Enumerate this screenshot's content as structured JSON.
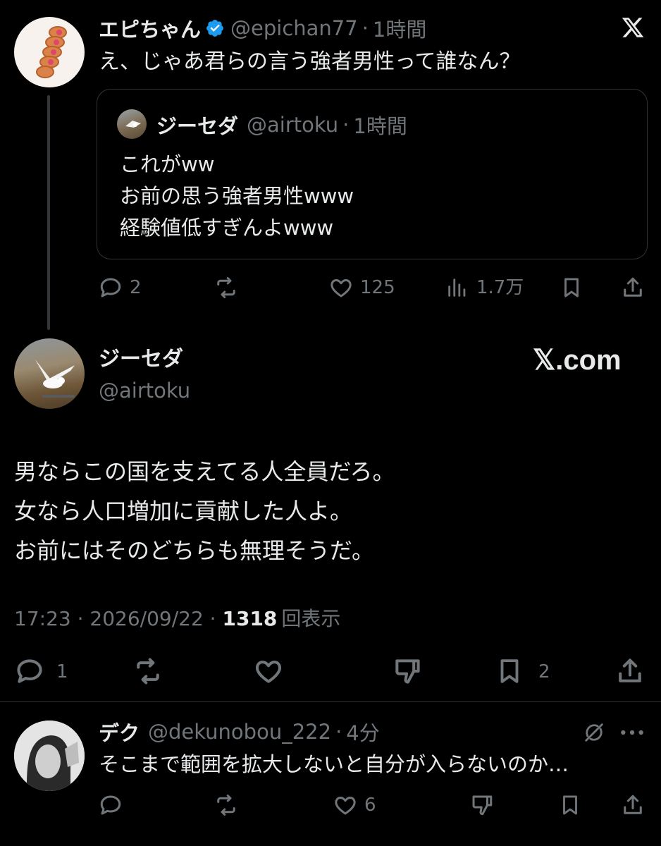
{
  "post1": {
    "display_name": "エピちゃん",
    "handle": "@epichan77",
    "time": "1時間",
    "text": "え、じゃあ君らの言う強者男性って誰なん？",
    "quote": {
      "display_name": "ジーセダ",
      "handle": "@airtoku",
      "time": "1時間",
      "lines": [
        "これがww",
        "お前の思う強者男性www",
        "経験値低すぎんよwww"
      ]
    },
    "actions": {
      "replies": "2",
      "likes": "125",
      "views": "1.7万"
    }
  },
  "post2": {
    "display_name": "ジーセダ",
    "handle": "@airtoku",
    "lines": [
      "男ならこの国を支えてる人全員だろ。",
      "女なら人口増加に貢献した人よ。",
      "お前にはそのどちらも無理そうだ。"
    ],
    "meta_time": "17:23 · 2026/09/22 · ",
    "views": "1318",
    "views_label": "回表示",
    "actions": {
      "replies": "1",
      "bookmarks": "2"
    }
  },
  "watermark": "𝕏.com",
  "reply": {
    "display_name": "デク",
    "handle": "@dekunobou_222",
    "time": "4分",
    "text": "そこまで範囲を拡大しないと自分が入らないのか…",
    "actions": {
      "likes": "6"
    }
  },
  "sep": "·",
  "colors": {
    "background": "#000000",
    "text": "#e7e9ea",
    "muted": "#71767b",
    "verified": "#1d9bf0",
    "border": "#2f3336"
  }
}
